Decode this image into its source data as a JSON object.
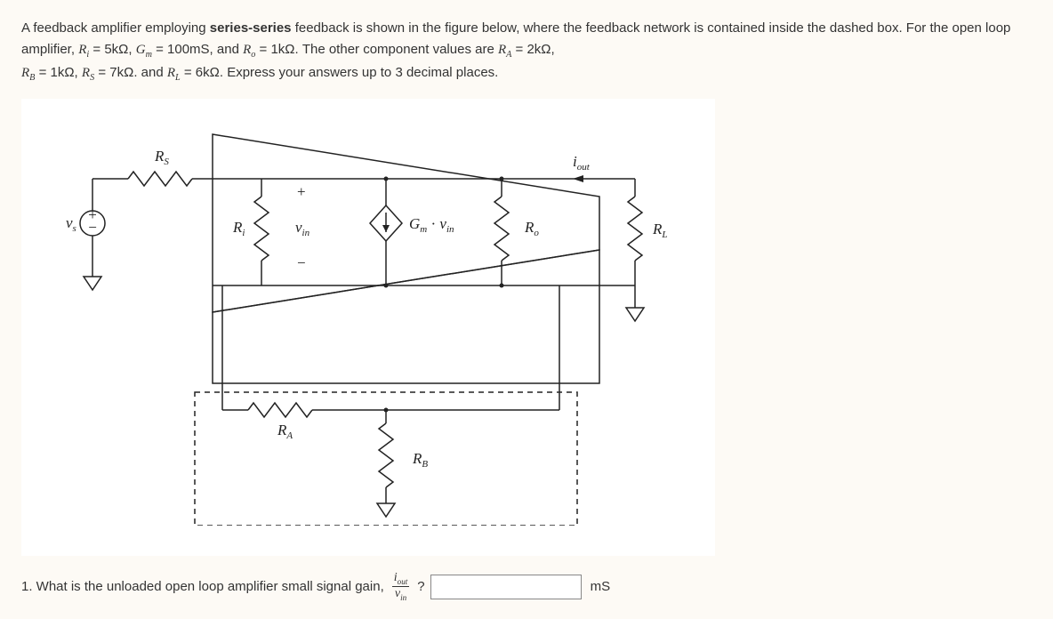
{
  "problem": {
    "intro_prefix": "A feedback amplifier employing ",
    "feedback_type_bold": "series-series",
    "intro_suffix": " feedback is shown in the figure below, where the feedback network is contained inside the dashed box. For the open loop amplifier, ",
    "Ri_sym": "R",
    "Ri_sub": "i",
    "Ri_val": " = 5kΩ, ",
    "Gm_sym": "G",
    "Gm_sub": "m",
    "Gm_val": " = 100mS, and ",
    "Ro_sym": "R",
    "Ro_sub": "o",
    "Ro_val": " = 1kΩ. The other component values are ",
    "RA_sym": "R",
    "RA_sub": "A",
    "RA_val": " = 2kΩ, ",
    "RB_sym": "R",
    "RB_sub": "B",
    "RB_val": " = 1kΩ, ",
    "RS_sym": "R",
    "RS_sub": "S",
    "RS_val": " = 7kΩ. and ",
    "RL_sym": "R",
    "RL_sub": "L",
    "RL_val": " = 6kΩ. Express your answers up to 3 decimal places."
  },
  "circuit_labels": {
    "vs": "v",
    "vs_sub": "s",
    "RS": "R",
    "RS_sub": "S",
    "Ri": "R",
    "Ri_sub": "i",
    "vin": "v",
    "vin_sub": "in",
    "Gm": "G",
    "Gm_sub": "m",
    "vin2": "v",
    "vin2_sub": "in",
    "dot": " · ",
    "Ro": "R",
    "Ro_sub": "o",
    "iout": "i",
    "iout_sub": "out",
    "RL": "R",
    "RL_sub": "L",
    "RA": "R",
    "RA_sub": "A",
    "RB": "R",
    "RB_sub": "B",
    "plus": "+",
    "minus": "−"
  },
  "question1": {
    "number_text": "1. What is the unloaded open loop amplifier small signal gain, ",
    "frac_num": "i",
    "frac_num_sub": "out",
    "frac_den": "v",
    "frac_den_sub": "in",
    "qmark": " ?",
    "unit": "mS",
    "answer_value": ""
  }
}
